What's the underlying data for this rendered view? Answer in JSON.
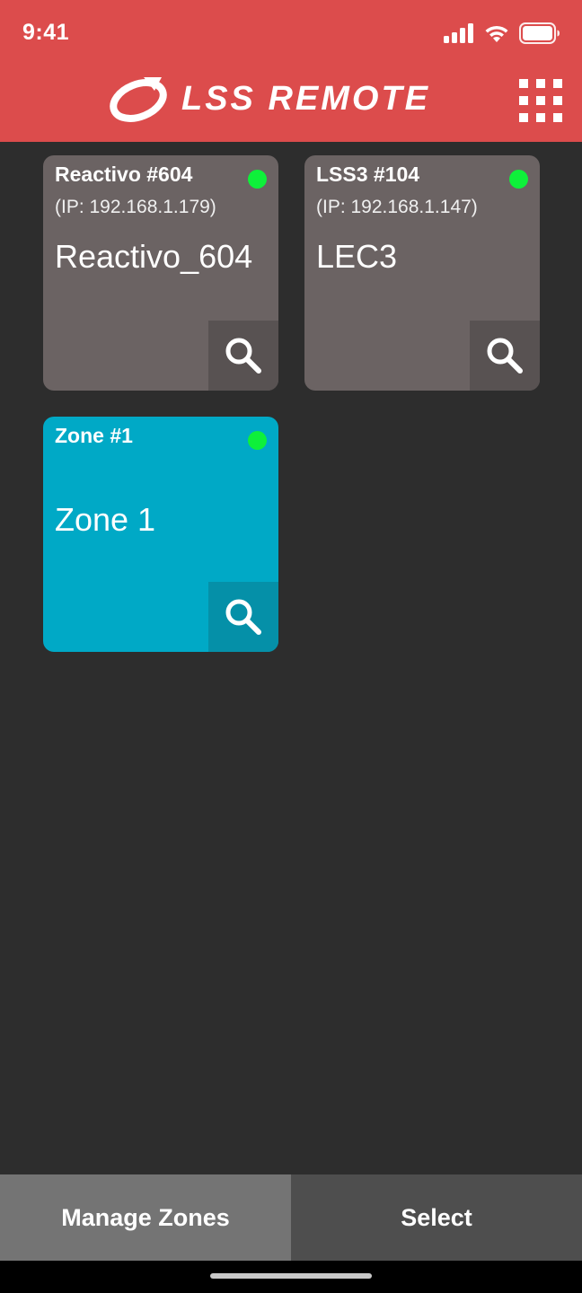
{
  "status_bar": {
    "time": "9:41",
    "icons": [
      "signal-icon",
      "wifi-icon",
      "battery-icon"
    ]
  },
  "header": {
    "brand": "LSS REMOTE",
    "menu_icon": "grid-icon",
    "background_color": "#dc4c4c"
  },
  "devices": [
    {
      "title": "Reactivo #604",
      "ip": "(IP: 192.168.1.179)",
      "name": "Reactivo_604",
      "status_color": "#0ef03a"
    },
    {
      "title": "LSS3 #104",
      "ip": "(IP: 192.168.1.147)",
      "name": "LEC3",
      "status_color": "#0ef03a"
    }
  ],
  "zones": [
    {
      "title": "Zone #1",
      "name": "Zone 1",
      "status_color": "#0ef03a",
      "background_color": "#00a9c6"
    }
  ],
  "footer": {
    "manage_label": "Manage Zones",
    "select_label": "Select"
  }
}
